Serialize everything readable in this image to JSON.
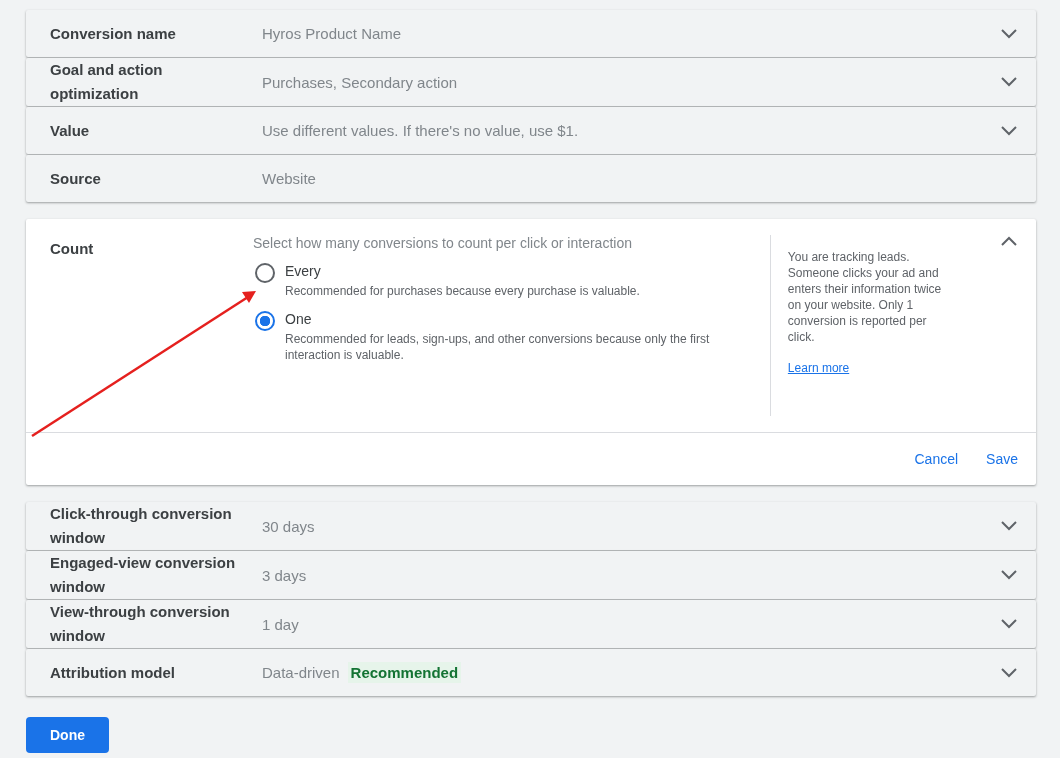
{
  "sections": [
    {
      "kind": "row",
      "label": "Conversion name",
      "value": "Hyros Product Name",
      "expandable": true
    },
    {
      "kind": "row",
      "label": "Goal and action optimization",
      "value": "Purchases, Secondary action",
      "expandable": true
    },
    {
      "kind": "row",
      "label": "Value",
      "value": "Use different values. If there's no value, use $1.",
      "expandable": true
    },
    {
      "kind": "row",
      "label": "Source",
      "value": "Website",
      "expandable": false
    },
    {
      "kind": "expanded",
      "label": "Count",
      "prompt": "Select how many conversions to count per click or interaction",
      "options": [
        {
          "label": "Every",
          "description": "Recommended for purchases because every purchase is valuable.",
          "selected": false
        },
        {
          "label": "One",
          "description": "Recommended for leads, sign-ups, and other conversions because only the first interaction is valuable.",
          "selected": true
        }
      ],
      "help": "You are tracking leads. Someone clicks your ad and enters their information twice on your website. Only 1 conversion is reported per click.",
      "help_link": "Learn more",
      "actions": [
        "Cancel",
        "Save"
      ]
    },
    {
      "kind": "row",
      "label": "Click-through conversion window",
      "value": "30 days",
      "expandable": true
    },
    {
      "kind": "row",
      "label": "Engaged-view conversion window",
      "value": "3 days",
      "expandable": true
    },
    {
      "kind": "row",
      "label": "View-through conversion window",
      "value": "1 day",
      "expandable": true
    },
    {
      "kind": "row",
      "label": "Attribution model",
      "value": "Data-driven",
      "badge": "Recommended",
      "expandable": true
    }
  ],
  "done_button": "Done"
}
